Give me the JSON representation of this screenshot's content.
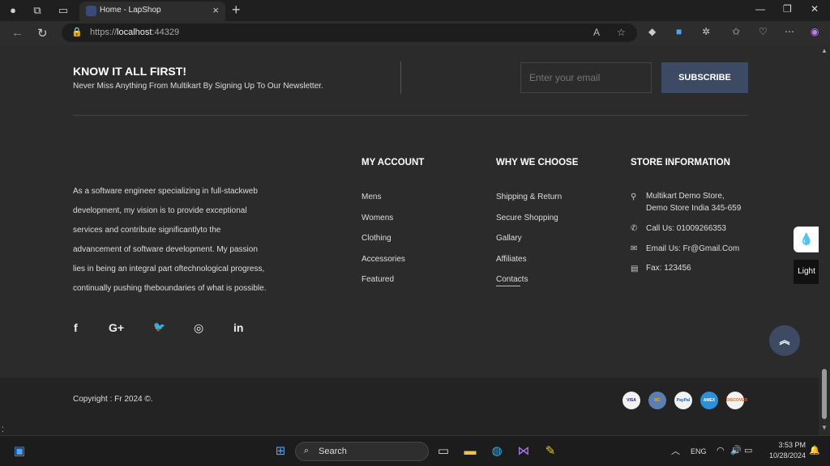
{
  "browser": {
    "tab_title": "Home - LapShop",
    "url_prefix": "https://",
    "url_host": "localhost",
    "url_port": ":44329"
  },
  "newsletter": {
    "title": "KNOW IT ALL FIRST!",
    "subtitle": "Never Miss Anything From Multikart By Signing Up To Our Newsletter.",
    "email_placeholder": "Enter your email",
    "subscribe_label": "SUBSCRIBE"
  },
  "about": {
    "lines": [
      "As a software engineer specializing in full-stackweb",
      "development, my vision is to provide exceptional",
      "services and contribute significantlyto the",
      "advancement of software development. My passion",
      "lies in being an integral part oftechnological progress,",
      "continually pushing theboundaries of what is possible."
    ]
  },
  "my_account": {
    "title": "MY ACCOUNT",
    "links": [
      "Mens",
      "Womens",
      "Clothing",
      "Accessories",
      "Featured"
    ]
  },
  "why_we_choose": {
    "title": "WHY WE CHOOSE",
    "links": [
      "Shipping & Return",
      "Secure Shopping",
      "Gallary",
      "Affiliates",
      "Contacts"
    ]
  },
  "store_info": {
    "title": "STORE INFORMATION",
    "address_line1": "Multikart Demo Store,",
    "address_line2": "Demo Store India 345-659",
    "phone": "Call Us: 01009266353",
    "email": "Email Us: Fr@Gmail.Com",
    "fax": "Fax: 123456"
  },
  "social": {
    "facebook": "f",
    "google": "G+",
    "twitter": "🐦",
    "instagram": "◎",
    "linkedin": "in"
  },
  "theme": {
    "light_label": "Light"
  },
  "bottom": {
    "copyright": "Copyright : Fr 2024 ©.",
    "payments": [
      "VISA",
      "MC",
      "PayPal",
      "AMEX",
      "DISCOVER"
    ]
  },
  "taskbar": {
    "search_label": "Search",
    "lang": "ENG",
    "time": "3:53 PM",
    "date": "10/28/2024"
  },
  "colors": {
    "accent": "#3d4a63",
    "page_bg": "#2b2b2b"
  }
}
